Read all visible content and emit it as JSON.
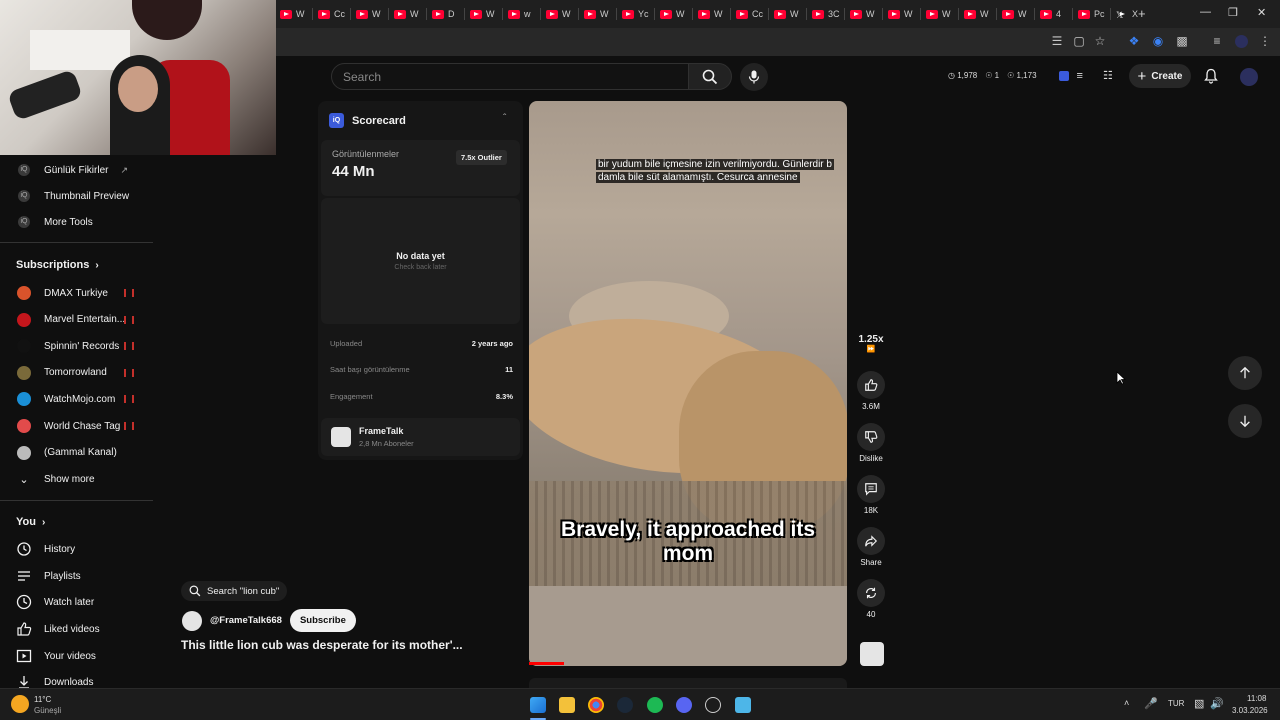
{
  "browser": {
    "tabs": [
      "W",
      "Cc",
      "W",
      "W",
      "D",
      "W",
      "w",
      "W",
      "W",
      "Yc",
      "W",
      "W",
      "Cc",
      "W",
      "3C",
      "W",
      "W",
      "W",
      "W",
      "W",
      "4",
      "Pc",
      "X"
    ],
    "new_tab_icon": "plus-icon",
    "window_controls": [
      "minimize-icon",
      "restore-icon",
      "close-icon"
    ]
  },
  "header": {
    "search_placeholder": "Search",
    "stats": {
      "watch_time": "1,978",
      "eye1": "1",
      "views": "1,173"
    },
    "create_label": "Create"
  },
  "sidebar": {
    "tools": [
      {
        "label": "Günlük Fikirler"
      },
      {
        "label": "Thumbnail Preview"
      },
      {
        "label": "More Tools"
      }
    ],
    "subscriptions_title": "Subscriptions",
    "subscriptions": [
      {
        "label": "DMAX Turkiye",
        "color": "#d9532b"
      },
      {
        "label": "Marvel Entertain...",
        "color": "#c4161c"
      },
      {
        "label": "Spinnin' Records",
        "color": "#111111"
      },
      {
        "label": "Tomorrowland",
        "color": "#7a6a3a"
      },
      {
        "label": "WatchMojo.com",
        "color": "#1a8fd6"
      },
      {
        "label": "World Chase Tag",
        "color": "#e24b4b"
      },
      {
        "label": "(Gammal Kanal)",
        "color": "#bbbbbb"
      }
    ],
    "show_more": "Show more",
    "you_title": "You",
    "you_items": [
      {
        "label": "History",
        "icon": "history-icon"
      },
      {
        "label": "Playlists",
        "icon": "playlists-icon"
      },
      {
        "label": "Watch later",
        "icon": "clock-icon"
      },
      {
        "label": "Liked videos",
        "icon": "thumb-up-icon"
      },
      {
        "label": "Your videos",
        "icon": "play-box-icon"
      },
      {
        "label": "Downloads",
        "icon": "download-icon"
      }
    ]
  },
  "scorecard": {
    "badge": "iQ",
    "title": "Scorecard",
    "views_label": "Görüntülenmeler",
    "views_value": "44 Mn",
    "outlier": "7.5x Outlier",
    "no_data": "No data yet",
    "check_back": "Check back later",
    "rows": [
      {
        "label": "Uploaded",
        "value": "2 years ago"
      },
      {
        "label": "Saat başı görüntülenme",
        "value": "11"
      },
      {
        "label": "Engagement",
        "value": "8.3%"
      }
    ],
    "channel_name": "FrameTalk",
    "channel_subs": "2,8 Mn Aboneler"
  },
  "video": {
    "top_caption_line1": "bir yudum bile içmesine izin verilmiyordu. Günlerdir b",
    "top_caption_line2": "damla bile süt alamamıştı. Cesurca annesine",
    "big_caption_line1": "Bravely, it approached its",
    "big_caption_line2": "mom",
    "progress": 0.11
  },
  "actions": {
    "speed": "1.25x",
    "likes": "3.6M",
    "dislike": "Dislike",
    "comments": "18K",
    "share": "Share",
    "remix": "40"
  },
  "meta": {
    "search_chip": "Search \"lion cub\"",
    "channel_handle": "@FrameTalk668",
    "subscribe": "Subscribe",
    "title": "This little lion cub was desperate for its mother'..."
  },
  "taskbar": {
    "weather_temp": "11°C",
    "weather_desc": "Güneşli",
    "lang": "TUR",
    "time": "11:08",
    "date": "3.03.2026"
  },
  "colors": {
    "accent": "#ff0000",
    "brand": "#ff0033"
  }
}
